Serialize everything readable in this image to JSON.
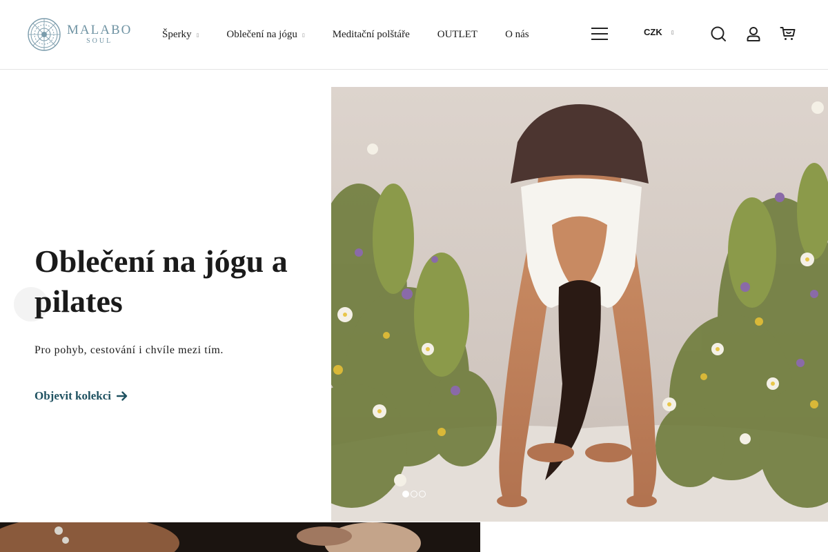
{
  "brand": {
    "name": "MALABO",
    "sub": "SOUL",
    "logo_icon": "mandala-icon",
    "color": "#6f93a3"
  },
  "nav": {
    "items": [
      {
        "label": "Šperky",
        "has_dropdown": true
      },
      {
        "label": "Oblečení na jógu",
        "has_dropdown": true
      },
      {
        "label": "Meditační polštáře",
        "has_dropdown": false
      },
      {
        "label": "OUTLET",
        "has_dropdown": false
      },
      {
        "label": "O nás",
        "has_dropdown": false
      }
    ],
    "caret_glyph": "▯"
  },
  "header": {
    "menu_icon": "hamburger-menu-icon",
    "currency": "CZK",
    "search_icon": "search-icon",
    "account_icon": "user-icon",
    "cart_icon": "cart-icon"
  },
  "hero": {
    "title": "Oblečení na jógu a pilates",
    "subtitle": "Pro pohyb, cestování i chvíle mezi tím.",
    "cta_label": "Objevit kolekci",
    "cta_icon": "arrow-right-icon",
    "cta_color": "#1e5160",
    "image": "yoga-forward-bend-photo",
    "slides_total": 3,
    "active_slide": 1
  },
  "promo": {
    "image": "jewelry-hand-photo"
  }
}
